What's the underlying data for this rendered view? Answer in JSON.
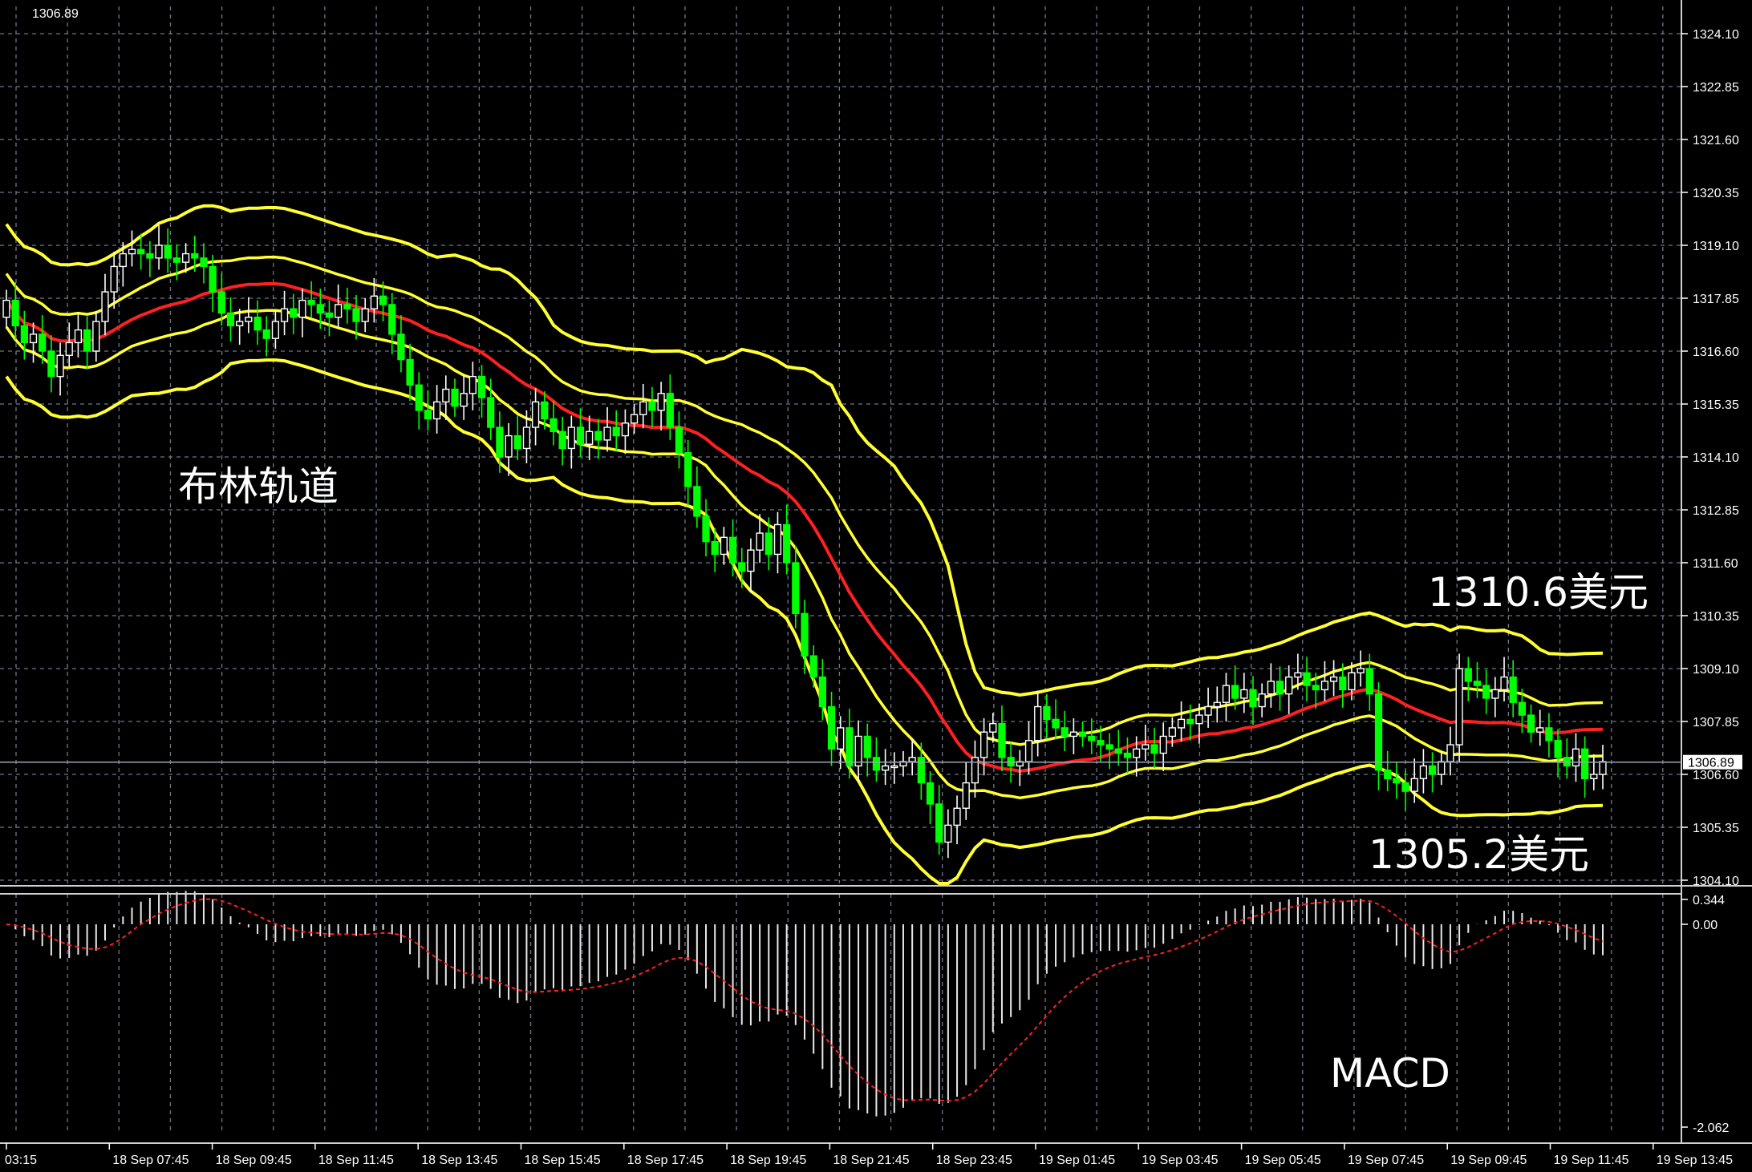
{
  "header": {
    "corner_text": "1306.89"
  },
  "labels": {
    "bollinger": "布林轨道",
    "upper_level": "1310.6美元",
    "lower_level": "1305.2美元",
    "macd": "MACD"
  },
  "colors": {
    "background": "#000000",
    "grid": "#6e7787",
    "bull_candle": "#ffffff",
    "bear_candle": "#00ff00",
    "bollinger_band": "#ffff33",
    "middle_band": "#ff2020",
    "macd_signal": "#ff2020",
    "current_price_line": "#9aa6b8"
  },
  "chart_data": [
    {
      "type": "candlestick",
      "title": "",
      "current_price": 1306.89,
      "y_ticks": [
        "1324.10",
        "1322.85",
        "1321.60",
        "1320.35",
        "1319.10",
        "1317.85",
        "1316.60",
        "1315.35",
        "1314.10",
        "1312.85",
        "1311.60",
        "1310.35",
        "1309.10",
        "1307.85",
        "1306.60",
        "1305.35",
        "1304.10"
      ],
      "ylim": [
        1304.1,
        1324.6
      ],
      "x_ticks": [
        "03:15",
        "18 Sep 07:45",
        "18 Sep 09:45",
        "18 Sep 11:45",
        "18 Sep 13:45",
        "18 Sep 15:45",
        "18 Sep 17:45",
        "18 Sep 19:45",
        "18 Sep 21:45",
        "18 Sep 23:45",
        "19 Sep 01:45",
        "19 Sep 03:45",
        "19 Sep 05:45",
        "19 Sep 07:45",
        "19 Sep 09:45",
        "19 Sep 11:45",
        "19 Sep 13:45"
      ],
      "grid": true,
      "closes": [
        1317.8,
        1317.2,
        1316.8,
        1317.0,
        1316.6,
        1316.0,
        1316.5,
        1316.8,
        1317.1,
        1316.6,
        1317.3,
        1318.0,
        1318.6,
        1318.9,
        1319.0,
        1318.9,
        1318.8,
        1319.1,
        1318.8,
        1318.7,
        1318.9,
        1318.8,
        1318.6,
        1318.0,
        1317.5,
        1317.2,
        1317.3,
        1317.4,
        1317.1,
        1316.9,
        1317.3,
        1317.6,
        1317.4,
        1317.8,
        1317.7,
        1317.5,
        1317.4,
        1317.7,
        1317.6,
        1317.3,
        1317.6,
        1317.9,
        1317.7,
        1317.0,
        1316.4,
        1315.8,
        1315.2,
        1315.0,
        1315.4,
        1315.7,
        1315.3,
        1315.6,
        1316.0,
        1315.5,
        1314.8,
        1314.1,
        1314.6,
        1314.3,
        1314.8,
        1315.4,
        1315.0,
        1314.7,
        1314.3,
        1314.8,
        1314.4,
        1314.7,
        1314.5,
        1314.8,
        1314.6,
        1314.9,
        1315.1,
        1315.4,
        1315.2,
        1315.6,
        1314.8,
        1314.2,
        1313.4,
        1312.7,
        1312.1,
        1311.8,
        1312.2,
        1311.6,
        1311.4,
        1311.9,
        1312.3,
        1311.8,
        1312.5,
        1311.6,
        1310.4,
        1309.4,
        1308.9,
        1308.2,
        1307.2,
        1307.7,
        1306.8,
        1307.5,
        1307.0,
        1306.7,
        1306.8,
        1306.8,
        1306.9,
        1307.0,
        1306.4,
        1305.9,
        1305.0,
        1305.4,
        1305.8,
        1306.4,
        1307.0,
        1307.6,
        1307.8,
        1307.0,
        1306.8,
        1306.9,
        1307.4,
        1308.2,
        1307.9,
        1307.7,
        1307.5,
        1307.6,
        1307.5,
        1307.4,
        1307.3,
        1307.2,
        1307.1,
        1307.0,
        1307.2,
        1307.3,
        1307.1,
        1307.5,
        1307.7,
        1307.9,
        1307.8,
        1308.0,
        1308.2,
        1308.3,
        1308.7,
        1308.4,
        1308.6,
        1308.2,
        1308.5,
        1308.8,
        1308.5,
        1308.9,
        1309.0,
        1308.7,
        1308.6,
        1308.8,
        1308.9,
        1308.6,
        1309.0,
        1309.1,
        1308.5,
        1306.7,
        1306.5,
        1306.4,
        1306.2,
        1306.5,
        1306.8,
        1306.6,
        1306.9,
        1307.3,
        1309.1,
        1308.8,
        1308.7,
        1308.4,
        1308.6,
        1308.9,
        1308.3,
        1308.0,
        1307.6,
        1307.7,
        1307.4,
        1307.0,
        1306.8,
        1307.2,
        1306.5,
        1306.6,
        1306.9
      ]
    },
    {
      "type": "macd",
      "title": "",
      "y_ticks": [
        "0.344",
        "0.00",
        "-2.062"
      ],
      "ylim": [
        -2.062,
        0.344
      ]
    }
  ]
}
